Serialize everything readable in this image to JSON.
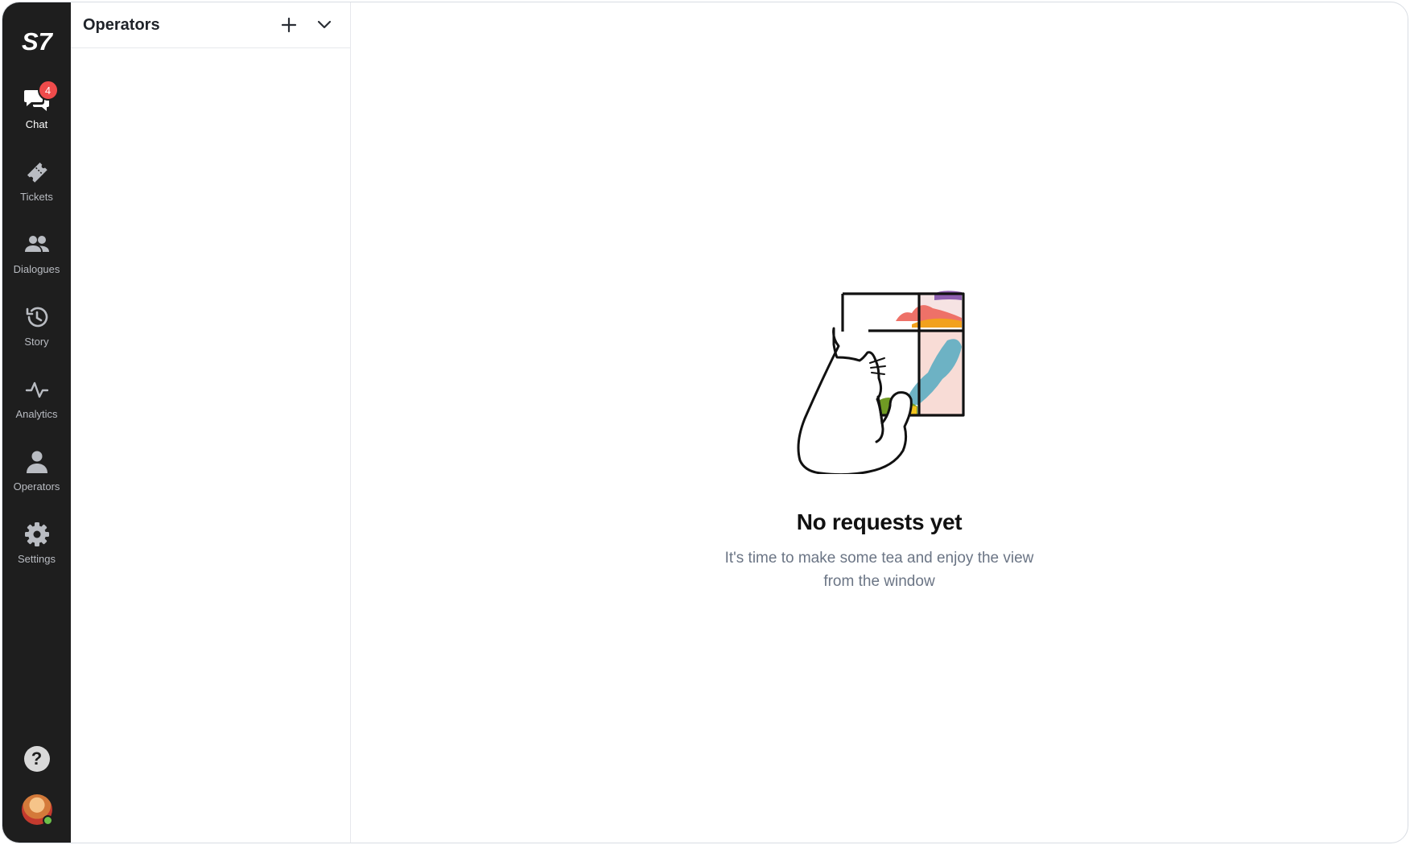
{
  "brand": {
    "logo_text": "S7"
  },
  "nav": {
    "items": [
      {
        "label": "Chat",
        "icon": "chat-bubbles-icon",
        "badge": "4",
        "active": true
      },
      {
        "label": "Tickets",
        "icon": "ticket-icon"
      },
      {
        "label": "Dialogues",
        "icon": "people-icon"
      },
      {
        "label": "Story",
        "icon": "history-clock-icon"
      },
      {
        "label": "Analytics",
        "icon": "pulse-chart-icon"
      },
      {
        "label": "Operators",
        "icon": "person-icon"
      },
      {
        "label": "Settings",
        "icon": "gear-icon"
      }
    ],
    "help_glyph": "?"
  },
  "panel": {
    "title": "Operators"
  },
  "empty_state": {
    "title": "No requests yet",
    "subtitle": "It's time to make some tea and enjoy the view from the window"
  },
  "colors": {
    "rail_bg": "#1e1e1e",
    "badge": "#ef4b4b",
    "online": "#6cc04a"
  }
}
